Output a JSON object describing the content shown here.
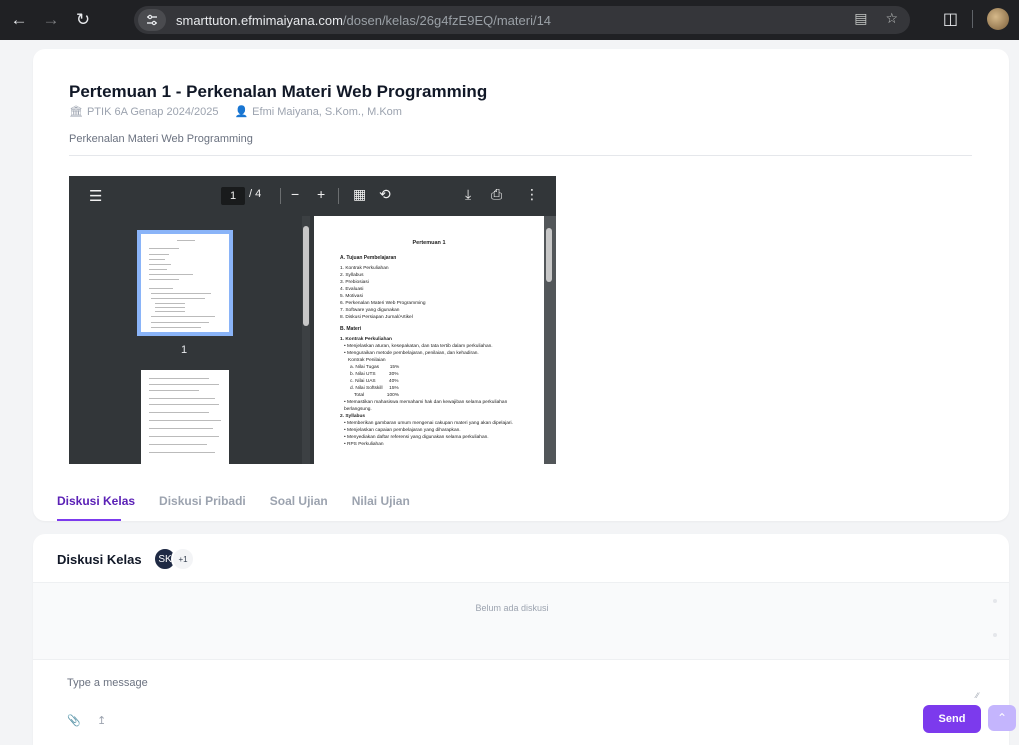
{
  "browser": {
    "url_host": "smarttuton.efmimaiyana.com",
    "url_path": "/dosen/kelas/26g4fzE9EQ/materi/14"
  },
  "material": {
    "title": "Pertemuan 1 - Perkenalan Materi Web Programming",
    "class_name": "PTIK 6A Genap 2024/2025",
    "lecturer": "Efmi Maiyana, S.Kom., M.Kom",
    "description": "Perkenalan Materi Web Programming"
  },
  "pdf_viewer": {
    "current_page": "1",
    "total_pages": "/ 4",
    "thumb_label": "1",
    "page": {
      "title": "Pertemuan 1",
      "section_a": "A. Tujuan Pembelajaran",
      "goals": [
        "1. Kontrak Perkuliahan",
        "2. Syllabus",
        "3. Prebiosiasi",
        "4. Evaluasi",
        "5. Motivasi",
        "6. Perkenalan Materi Web Programming",
        "7. Software yang digunakan",
        "8. Diskusi Persiapan Jurnal/Artikel"
      ],
      "section_b": "B. Materi",
      "materi": [
        "1. Kontrak Perkuliahan",
        "• Menjelaskan aturan, kesepakatan, dan tata tertib dalam perkuliahan.",
        "• Menguraikan metode pembelajaran, penilaian, dan kehadiran.",
        "Kontrak Penilaian",
        "a. Nilai Tugas        15%",
        "b. Nilai UTS          30%",
        "c. Nilai UAS          40%",
        "d. Nilai Softskill     15%",
        "Total                 100%",
        "• Memastikan mahasiswa memahami hak dan kewajiban selama perkuliahan berlangsung.",
        "2. Syllabus",
        "• Memberikan gambaran umum mengenai cakupan materi yang akan dipelajari.",
        "• Menjelaskan capaian pembelajaran yang diharapkan.",
        "• Menyediakan daftar referensi yang digunakan selama perkuliahan.",
        "• RPS Perkuliahan"
      ]
    }
  },
  "tabs": [
    {
      "label": "Diskusi Kelas",
      "active": true
    },
    {
      "label": "Diskusi Pribadi",
      "active": false
    },
    {
      "label": "Soal Ujian",
      "active": false
    },
    {
      "label": "Nilai Ujian",
      "active": false
    }
  ],
  "discussion": {
    "title": "Diskusi Kelas",
    "avatar_initials": "SK",
    "extra_count": "+1",
    "empty_text": "Belum ada diskusi",
    "input_placeholder": "Type a message",
    "send_label": "Send"
  },
  "colors": {
    "accent": "#7c3aed",
    "accent_light": "#c4b5fd",
    "chrome_bg": "#202124"
  },
  "icons": [
    "back-icon",
    "forward-icon",
    "reload-icon",
    "site-settings-icon",
    "translate-icon",
    "star-icon",
    "extensions-icon",
    "menu-icon",
    "zoom-out-icon",
    "zoom-in-icon",
    "fit-page-icon",
    "rotate-icon",
    "download-icon",
    "print-icon",
    "more-icon",
    "class-icon",
    "user-icon",
    "attach-icon",
    "upload-icon",
    "scroll-top-icon"
  ]
}
